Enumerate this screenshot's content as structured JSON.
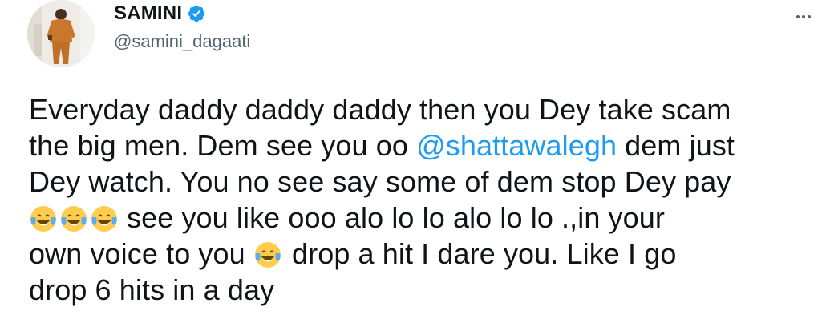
{
  "author": {
    "display_name": "SAMINI",
    "handle": "@samini_dagaati",
    "verified": true,
    "avatar_icon": "avatar-photo"
  },
  "menu": {
    "icon": "more-horizontal-icon"
  },
  "tweet": {
    "line1": "Everyday daddy daddy daddy then you Dey take scam",
    "line2_before": "the big men. Dem see you oo ",
    "mention": "@shattawalegh",
    "line2_after": " dem just",
    "line3": "Dey watch. You no see say some of dem stop Dey pay",
    "line4_after_emoji": "see you like ooo alo lo lo alo lo lo .,in your",
    "line5_before_emoji": "own voice to you",
    "line5_after_emoji": "drop a hit I dare you. Like I go",
    "line6": "drop 6 hits in a day",
    "emoji_name": "face-with-tears-of-joy"
  },
  "colors": {
    "text": "#0f1419",
    "secondary": "#536471",
    "link": "#1d9bf0",
    "verified": "#1d9bf0",
    "emoji_face": "#ffcc4d",
    "emoji_tears": "#5dadec"
  }
}
